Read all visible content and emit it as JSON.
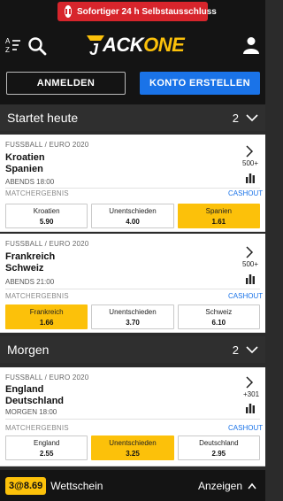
{
  "banner": {
    "self_exclusion_label": "Sofortiger 24 h Selbstausschluss"
  },
  "header": {
    "logo_prefix": "J",
    "logo_middle": "ACK",
    "logo_suffix": "ONE"
  },
  "auth": {
    "login_label": "ANMELDEN",
    "register_label": "KONTO ERSTELLEN"
  },
  "sections": [
    {
      "title": "Startet heute",
      "count": "2"
    },
    {
      "title": "Morgen",
      "count": "2"
    }
  ],
  "matches": [
    {
      "league": "FUSSBALL / EURO 2020",
      "home": "Kroatien",
      "away": "Spanien",
      "time": "ABENDS 18:00",
      "more_markets": "500+",
      "market": "MATCHERGEBNIS",
      "cashout": "CASHOUT",
      "odds": [
        {
          "label": "Kroatien",
          "value": "5.90",
          "selected": false
        },
        {
          "label": "Unentschieden",
          "value": "4.00",
          "selected": false
        },
        {
          "label": "Spanien",
          "value": "1.61",
          "selected": true
        }
      ]
    },
    {
      "league": "FUSSBALL / EURO 2020",
      "home": "Frankreich",
      "away": "Schweiz",
      "time": "ABENDS 21:00",
      "more_markets": "500+",
      "market": "MATCHERGEBNIS",
      "cashout": "CASHOUT",
      "odds": [
        {
          "label": "Frankreich",
          "value": "1.66",
          "selected": true
        },
        {
          "label": "Unentschieden",
          "value": "3.70",
          "selected": false
        },
        {
          "label": "Schweiz",
          "value": "6.10",
          "selected": false
        }
      ]
    },
    {
      "league": "FUSSBALL / EURO 2020",
      "home": "England",
      "away": "Deutschland",
      "time": "MORGEN 18:00",
      "more_markets": "+301",
      "market": "MATCHERGEBNIS",
      "cashout": "CASHOUT",
      "odds": [
        {
          "label": "England",
          "value": "2.55",
          "selected": false
        },
        {
          "label": "Unentschieden",
          "value": "3.25",
          "selected": true
        },
        {
          "label": "Deutschland",
          "value": "2.95",
          "selected": false
        }
      ]
    }
  ],
  "betslip": {
    "badge": "3@8.69",
    "label": "Wettschein",
    "show_label": "Anzeigen"
  },
  "colors": {
    "accent_yellow": "#fcc10a",
    "brand_blue": "#1a73e8",
    "alert_red": "#d7252c",
    "header_dark": "#141414"
  }
}
